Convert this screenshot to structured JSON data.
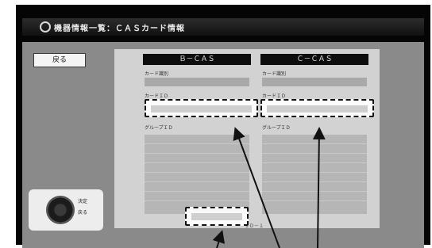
{
  "header": {
    "title": "機器情報一覧：ＣＡＳカード情報"
  },
  "back_button": {
    "label": "戻る"
  },
  "cards": [
    {
      "header": "Ｂ－ＣＡＳ",
      "card_id_label": "カード識別",
      "card_id_value": "",
      "card_number_label": "カードＩＤ",
      "card_number_value": "",
      "group_label": "グループＩＤ"
    },
    {
      "header": "Ｃ－ＣＡＳ",
      "card_id_label": "カード識別",
      "card_id_value": "",
      "card_number_label": "カードＩＤ",
      "card_number_value": "",
      "group_label": "グループＩＤ"
    }
  ],
  "bottom": {
    "label": "ＩＤ－１",
    "value": ""
  },
  "remote": {
    "label": "決定 戻る",
    "key_select": "決定",
    "key_back": "戻る"
  }
}
